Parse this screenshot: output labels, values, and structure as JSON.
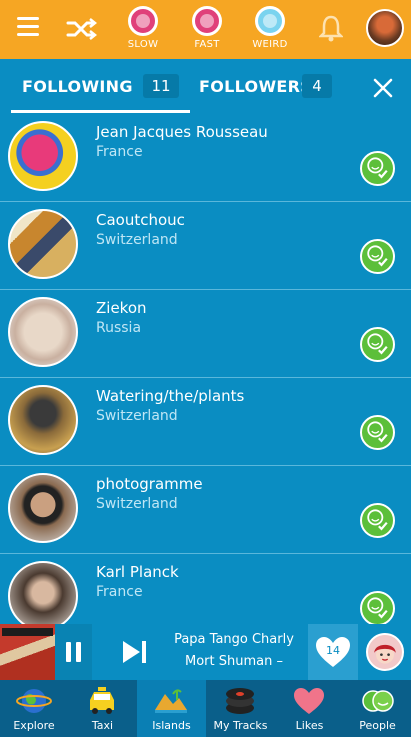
{
  "moods": [
    {
      "label": "SLOW"
    },
    {
      "label": "FAST"
    },
    {
      "label": "WEIRD"
    }
  ],
  "tabs": {
    "following_label": "FOLLOWING",
    "following_count": "11",
    "followers_label": "FOLLOWERS",
    "followers_count": "4"
  },
  "people": [
    {
      "name": "Jean Jacques Rousseau",
      "country": "France"
    },
    {
      "name": "Caoutchouc",
      "country": "Switzerland"
    },
    {
      "name": "Ziekon",
      "country": "Russia"
    },
    {
      "name": "Watering/the/plants",
      "country": "Switzerland"
    },
    {
      "name": "photogramme",
      "country": "Switzerland"
    },
    {
      "name": "Karl Planck",
      "country": "France"
    }
  ],
  "player": {
    "title": "Papa Tango Charly",
    "artist": "Mort Shuman –",
    "likes": "14"
  },
  "nav": [
    {
      "label": "Explore",
      "icon": "globe-icon"
    },
    {
      "label": "Taxi",
      "icon": "taxi-icon"
    },
    {
      "label": "Islands",
      "icon": "islands-icon"
    },
    {
      "label": "My Tracks",
      "icon": "records-icon"
    },
    {
      "label": "Likes",
      "icon": "heart-icon"
    },
    {
      "label": "People",
      "icon": "people-icon"
    }
  ],
  "colors": {
    "topbar": "#f6a623",
    "background": "#0a8dc2",
    "nav": "#0a5f8a",
    "follow_green": "#5cbf3a"
  }
}
